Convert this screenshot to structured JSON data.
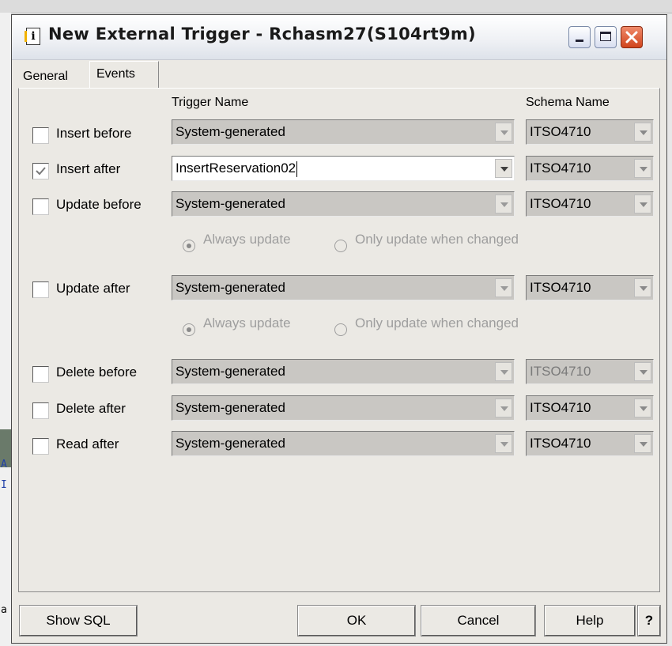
{
  "window": {
    "title": "New External Trigger - Rchasm27(S104rt9m)",
    "icon": "document-icon"
  },
  "tabs": [
    {
      "label": "General",
      "active": false
    },
    {
      "label": "Events",
      "active": true
    }
  ],
  "columns": {
    "trigger_name": "Trigger Name",
    "schema_name": "Schema Name"
  },
  "rows": [
    {
      "label": "Insert before",
      "checked": false,
      "trigger": "System-generated",
      "trigger_editable": false,
      "schema": "ITSO4710",
      "schema_enabled": true
    },
    {
      "label": "Insert after",
      "checked": true,
      "trigger": "InsertReservation02",
      "trigger_editable": true,
      "schema": "ITSO4710",
      "schema_enabled": true
    },
    {
      "label": "Update before",
      "checked": false,
      "trigger": "System-generated",
      "trigger_editable": false,
      "schema": "ITSO4710",
      "schema_enabled": true
    },
    {
      "label": "Update after",
      "checked": false,
      "trigger": "System-generated",
      "trigger_editable": false,
      "schema": "ITSO4710",
      "schema_enabled": true
    },
    {
      "label": "Delete before",
      "checked": false,
      "trigger": "System-generated",
      "trigger_editable": false,
      "schema": "ITSO4710",
      "schema_enabled": false
    },
    {
      "label": "Delete after",
      "checked": false,
      "trigger": "System-generated",
      "trigger_editable": false,
      "schema": "ITSO4710",
      "schema_enabled": false
    },
    {
      "label": "Read after",
      "checked": false,
      "trigger": "System-generated",
      "trigger_editable": false,
      "schema": "ITSO4710",
      "schema_enabled": false
    }
  ],
  "update_options": {
    "always": "Always update",
    "only_changed": "Only update when changed",
    "selected": "always"
  },
  "buttons": {
    "show_sql": "Show SQL",
    "ok": "OK",
    "cancel": "Cancel",
    "help": "Help",
    "help_q": "?"
  },
  "background": {
    "fragment_1": "A",
    "fragment_2": "I",
    "fragment_3": "a"
  },
  "colors": {
    "dialog_bg": "#ebe9e4",
    "disabled_field": "#c9c7c3",
    "close_button": "#d0441c"
  }
}
